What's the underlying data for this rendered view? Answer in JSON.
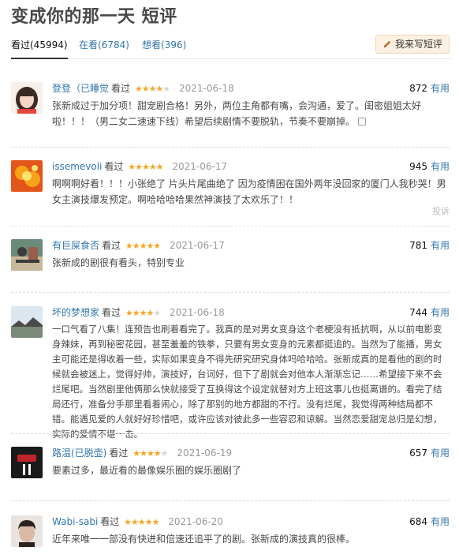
{
  "page": {
    "title": "变成你的那一天 短评"
  },
  "tabs": [
    {
      "label": "看过(45994)"
    },
    {
      "label": "在看(6784)"
    },
    {
      "label": "想看(396)"
    }
  ],
  "write_button": {
    "label": "我来写短评"
  },
  "useful_label": "有用",
  "report_label": "投诉",
  "reviews": [
    {
      "user": "登登（已睡觉",
      "status": "看过",
      "rating": 4,
      "date": "2021-06-18",
      "votes": "872",
      "text": "张新成过于加分项！甜宠剧合格！另外，两位主角都有嘴，会沟通，爱了。闺密姐姐太好啦！！！（男二女二速速下线）希望后续剧情不要脱轨，节奏不要崩掉。"
    },
    {
      "user": "issemevoli",
      "status": "看过",
      "rating": 5,
      "date": "2021-06-17",
      "votes": "945",
      "text": "啊啊啊好看！！！小张绝了 片头片尾曲绝了 因为疫情困在国外两年没回家的厦门人我秒哭！男女主演技爆发预定。啊哈哈哈哈果然神演技了太欢乐了！！"
    },
    {
      "user": "有巨屎食否",
      "status": "看过",
      "rating": 5,
      "date": "2021-06-17",
      "votes": "781",
      "text": "张新成的剧很有看头，特别专业"
    },
    {
      "user": "坏的梦想家",
      "status": "看过",
      "rating": 4,
      "date": "2021-06-18",
      "votes": "744",
      "text": "一口气看了八集！连预告也刷着看完了。我真的是对男女变身这个老梗没有抵抗啊，从以前电影变身辣妹，再到秘密花园，甚至羞羞的铁拳，只要有男女变身的元素都挺追的。当然为了能播，男女主可能还是得收着一些，实际如果变身不得先研究研究身体吗哈哈哈。张新成真的是看他的剧的时候就会被迷上，觉得好帅，演技好，台词好，但下了剧就会对他本人渐渐忘记……希望接下来不会烂尾吧。当然剧里他俩那么快就接受了互换得这个设定就替对方上班这事儿也挺离谱的。看完了结局还行，准备分手那里看着闹心，除了那别的地方都甜的不行。没有烂尾，我觉得两种结局都不错。能遇见爱的人就好好珍惜吧，或许应该对彼此多一些容忍和谅解。当然恋爱甜宠总归是幻想，实际的爱情不堪一击。"
    },
    {
      "user": "路温(已脱壶)",
      "status": "看过",
      "rating": 4,
      "date": "2021-06-19",
      "votes": "657",
      "text": "要素过多，最近看的最像娱乐圈的娱乐圈剧了"
    },
    {
      "user": "Wabi-sabi",
      "status": "看过",
      "rating": 5,
      "date": "2021-06-20",
      "votes": "684",
      "text": "近年来唯一一部没有快进和倍速还追平了的剧。张新成的演技真的很棒。"
    }
  ],
  "avatars": [
    {
      "icon": "girl-portrait-avatar",
      "colors": [
        "#f3d6c4",
        "#3a2a22",
        "#e8443a"
      ]
    },
    {
      "icon": "orange-flame-avatar",
      "colors": [
        "#e2561a",
        "#f7a21b",
        "#fde36b"
      ]
    },
    {
      "icon": "vintage-photo-avatar",
      "colors": [
        "#6b8b7a",
        "#c8b89a",
        "#3b3b3b"
      ]
    },
    {
      "icon": "sky-landscape-avatar",
      "colors": [
        "#dbe6ee",
        "#7a8a7a",
        "#4a4a4a"
      ]
    },
    {
      "icon": "red-seal-logo-avatar",
      "colors": [
        "#1a1a1a",
        "#c0242b",
        "#ffffff"
      ]
    },
    {
      "icon": "boy-portrait-avatar",
      "colors": [
        "#e9e4e0",
        "#2b2320",
        "#d9b9a6"
      ]
    }
  ]
}
